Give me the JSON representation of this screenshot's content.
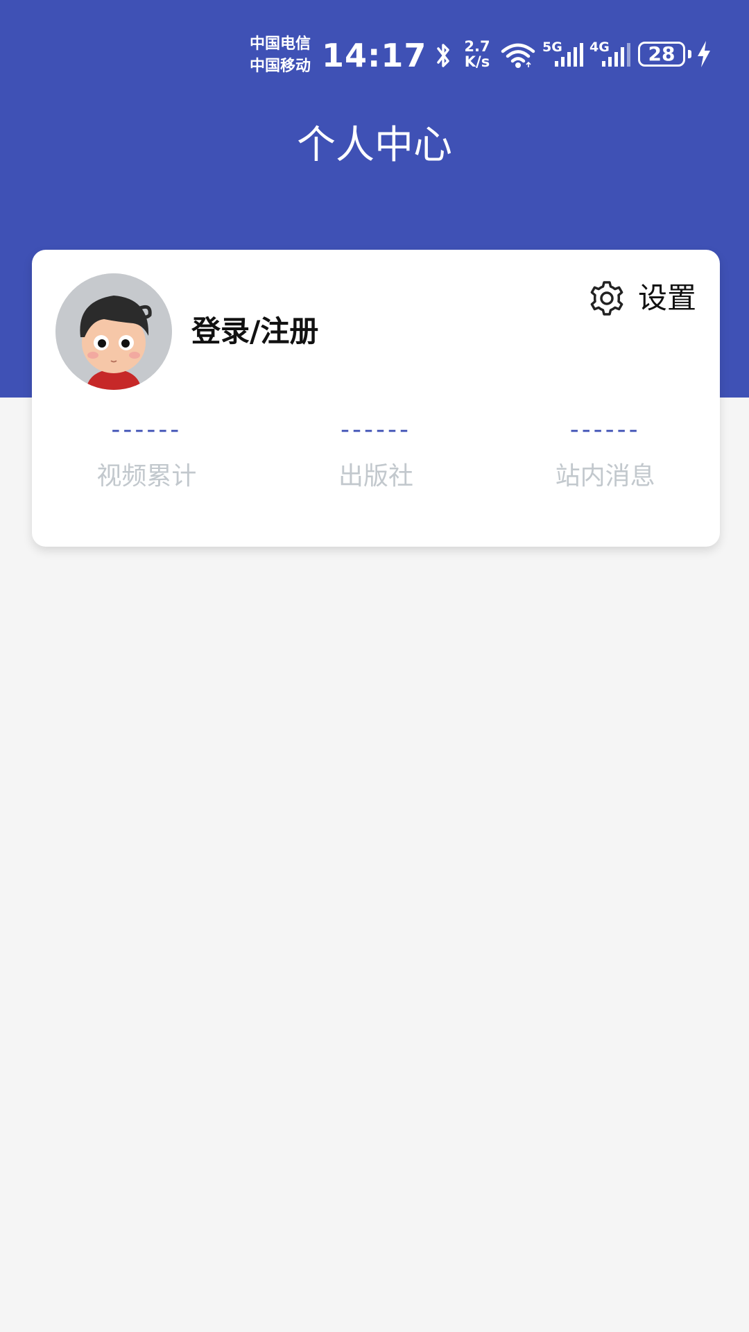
{
  "status_bar": {
    "carrier_1": "中国电信",
    "carrier_2": "中国移动",
    "time": "14:17",
    "net_speed_value": "2.7",
    "net_speed_unit": "K/s",
    "signal_1_label": "5G",
    "signal_2_label": "4G",
    "battery_level": "28",
    "icons": [
      "bluetooth-icon",
      "wifi-icon",
      "signal-5g-icon",
      "signal-4g-icon",
      "battery-icon",
      "charging-icon"
    ]
  },
  "header": {
    "title": "个人中心"
  },
  "profile": {
    "login_label": "登录/注册",
    "settings_label": "设置",
    "settings_icon": "gear-icon"
  },
  "stats": [
    {
      "value": "------",
      "label": "视频累计"
    },
    {
      "value": "------",
      "label": "出版社"
    },
    {
      "value": "------",
      "label": "站内消息"
    }
  ],
  "colors": {
    "primary": "#3f51b5",
    "background": "#f5f5f5",
    "card": "#ffffff",
    "stat_label": "#c2c8cd"
  }
}
